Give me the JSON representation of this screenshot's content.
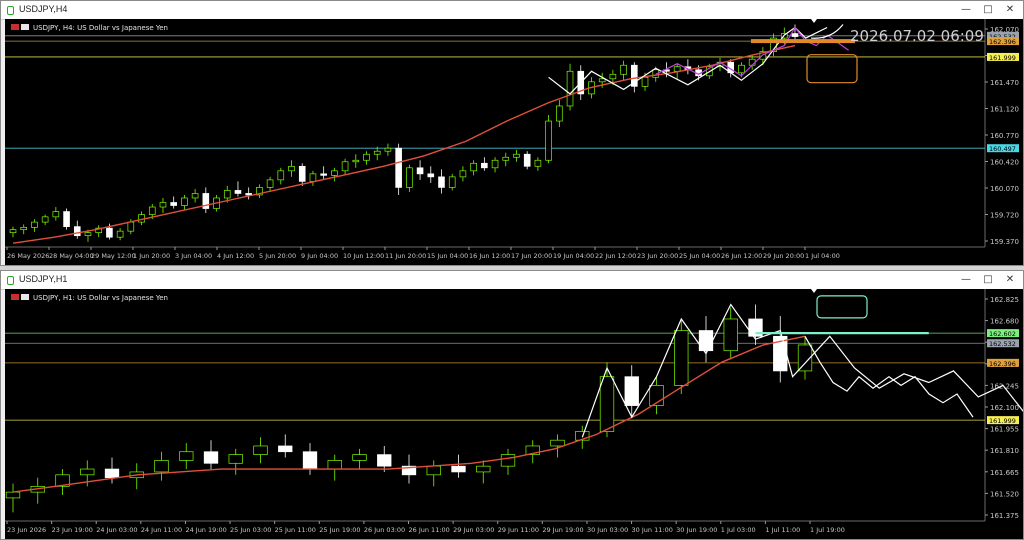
{
  "app": {
    "background": "#000000",
    "bull": "#7cfc00",
    "bear": "#ffffff",
    "ma_color": "#e0503c"
  },
  "windows": [
    {
      "id": "h4",
      "title": "USDJPY,H4",
      "symbol_label": "USDJPY, H4:  US Dollar vs Japanese Yen",
      "timestamp": "2026.07.02 06:09",
      "price_ticks": [
        "162.070",
        "161.820",
        "161.470",
        "161.120",
        "160.770",
        "160.420",
        "160.070",
        "159.720",
        "159.370"
      ],
      "price_range": [
        159.15,
        162.12
      ],
      "time_labels": [
        "26 May 2026",
        "28 May 04:00",
        "29 May 12:00",
        "1 Jun 20:00",
        "3 Jun 04:00",
        "4 Jun 12:00",
        "5 Jun 20:00",
        "9 Jun 04:00",
        "10 Jun 12:00",
        "11 Jun 20:00",
        "15 Jun 04:00",
        "16 Jun 12:00",
        "17 Jun 20:00",
        "19 Jun 04:00",
        "22 Jun 12:00",
        "23 Jun 20:00",
        "25 Jun 04:00",
        "26 Jun 12:00",
        "29 Jun 20:00",
        "1 Jul 04:00"
      ],
      "levels": [
        {
          "label": "162.532",
          "price": 161.95,
          "color": "#9aa3ad",
          "text": "#000000"
        },
        {
          "label": "162.396",
          "price": 161.88,
          "color": "#e0a03a",
          "text": "#000000"
        },
        {
          "label": "161.999",
          "price": 161.67,
          "color": "#f5ee55",
          "text": "#000000"
        },
        {
          "label": "160.497",
          "price": 160.46,
          "color": "#4ad6e6",
          "text": "#000000"
        }
      ],
      "candles": [
        [
          159.34,
          159.42,
          159.28,
          159.38
        ],
        [
          159.38,
          159.45,
          159.32,
          159.41
        ],
        [
          159.41,
          159.52,
          159.35,
          159.48
        ],
        [
          159.48,
          159.58,
          159.44,
          159.55
        ],
        [
          159.55,
          159.68,
          159.5,
          159.62
        ],
        [
          159.62,
          159.66,
          159.38,
          159.42
        ],
        [
          159.42,
          159.5,
          159.26,
          159.3
        ],
        [
          159.3,
          159.38,
          159.22,
          159.34
        ],
        [
          159.34,
          159.44,
          159.28,
          159.4
        ],
        [
          159.4,
          159.46,
          159.25,
          159.28
        ],
        [
          159.28,
          159.4,
          159.24,
          159.36
        ],
        [
          159.36,
          159.52,
          159.32,
          159.48
        ],
        [
          159.48,
          159.62,
          159.44,
          159.58
        ],
        [
          159.58,
          159.72,
          159.52,
          159.68
        ],
        [
          159.68,
          159.8,
          159.6,
          159.74
        ],
        [
          159.74,
          159.82,
          159.66,
          159.7
        ],
        [
          159.7,
          159.84,
          159.64,
          159.8
        ],
        [
          159.8,
          159.92,
          159.74,
          159.86
        ],
        [
          159.86,
          159.94,
          159.6,
          159.66
        ],
        [
          159.66,
          159.84,
          159.62,
          159.8
        ],
        [
          159.8,
          159.96,
          159.74,
          159.9
        ],
        [
          159.9,
          160.02,
          159.82,
          159.86
        ],
        [
          159.86,
          159.94,
          159.78,
          159.84
        ],
        [
          159.84,
          159.98,
          159.8,
          159.94
        ],
        [
          159.94,
          160.08,
          159.88,
          160.04
        ],
        [
          160.04,
          160.2,
          159.98,
          160.16
        ],
        [
          160.16,
          160.3,
          160.08,
          160.22
        ],
        [
          160.22,
          160.26,
          159.96,
          160.02
        ],
        [
          160.02,
          160.16,
          159.96,
          160.12
        ],
        [
          160.12,
          160.22,
          160.04,
          160.1
        ],
        [
          160.1,
          160.2,
          160.02,
          160.16
        ],
        [
          160.16,
          160.32,
          160.1,
          160.28
        ],
        [
          160.28,
          160.38,
          160.2,
          160.3
        ],
        [
          160.3,
          160.42,
          160.24,
          160.38
        ],
        [
          160.38,
          160.48,
          160.3,
          160.42
        ],
        [
          160.42,
          160.52,
          160.36,
          160.46
        ],
        [
          160.46,
          160.52,
          159.84,
          159.94
        ],
        [
          159.94,
          160.24,
          159.88,
          160.2
        ],
        [
          160.2,
          160.3,
          160.04,
          160.12
        ],
        [
          160.12,
          160.22,
          160.0,
          160.08
        ],
        [
          160.08,
          160.18,
          159.86,
          159.94
        ],
        [
          159.94,
          160.12,
          159.9,
          160.08
        ],
        [
          160.08,
          160.22,
          160.02,
          160.16
        ],
        [
          160.16,
          160.3,
          160.1,
          160.26
        ],
        [
          160.26,
          160.34,
          160.16,
          160.2
        ],
        [
          160.2,
          160.34,
          160.14,
          160.3
        ],
        [
          160.3,
          160.4,
          160.22,
          160.34
        ],
        [
          160.34,
          160.44,
          160.28,
          160.38
        ],
        [
          160.38,
          160.42,
          160.18,
          160.22
        ],
        [
          160.22,
          160.34,
          160.16,
          160.3
        ],
        [
          160.3,
          160.9,
          160.26,
          160.82
        ],
        [
          160.82,
          161.1,
          160.74,
          161.02
        ],
        [
          161.02,
          161.58,
          160.96,
          161.48
        ],
        [
          161.48,
          161.56,
          161.1,
          161.18
        ],
        [
          161.18,
          161.4,
          161.12,
          161.34
        ],
        [
          161.34,
          161.46,
          161.26,
          161.38
        ],
        [
          161.38,
          161.5,
          161.3,
          161.44
        ],
        [
          161.44,
          161.62,
          161.36,
          161.56
        ],
        [
          161.56,
          161.6,
          161.2,
          161.28
        ],
        [
          161.28,
          161.46,
          161.22,
          161.4
        ],
        [
          161.4,
          161.54,
          161.34,
          161.5
        ],
        [
          161.5,
          161.6,
          161.4,
          161.48
        ],
        [
          161.48,
          161.58,
          161.38,
          161.54
        ],
        [
          161.54,
          161.64,
          161.44,
          161.5
        ],
        [
          161.5,
          161.56,
          161.36,
          161.42
        ],
        [
          161.42,
          161.58,
          161.38,
          161.54
        ],
        [
          161.54,
          161.66,
          161.48,
          161.6
        ],
        [
          161.6,
          161.64,
          161.4,
          161.46
        ],
        [
          161.46,
          161.6,
          161.4,
          161.56
        ],
        [
          161.56,
          161.7,
          161.5,
          161.64
        ],
        [
          161.64,
          161.8,
          161.56,
          161.74
        ],
        [
          161.74,
          161.98,
          161.68,
          161.92
        ],
        [
          161.92,
          162.06,
          161.84,
          161.98
        ],
        [
          161.98,
          162.1,
          161.86,
          161.94
        ]
      ],
      "ma": [
        159.2,
        159.28,
        159.38,
        159.5,
        159.62,
        159.74,
        159.86,
        159.98,
        160.1,
        160.22,
        160.36,
        160.55,
        160.82,
        161.06,
        161.26,
        161.38,
        161.46,
        161.56,
        161.7,
        161.82
      ],
      "white_zigzag": [
        [
          50,
          161.4
        ],
        [
          52,
          161.18
        ],
        [
          54,
          161.48
        ],
        [
          57,
          161.24
        ],
        [
          60,
          161.52
        ],
        [
          63,
          161.3
        ],
        [
          66,
          161.56
        ],
        [
          68,
          161.36
        ],
        [
          70,
          161.58
        ],
        [
          72,
          161.96
        ],
        [
          73,
          162.06
        ],
        [
          74,
          161.92
        ],
        [
          76,
          162.06
        ]
      ],
      "magenta_zigzag": [
        [
          60,
          161.44
        ],
        [
          62,
          161.58
        ],
        [
          64,
          161.44
        ],
        [
          66,
          161.6
        ],
        [
          68,
          161.42
        ],
        [
          70,
          161.7
        ],
        [
          72,
          161.82
        ],
        [
          73,
          162.06
        ],
        [
          74,
          161.88
        ],
        [
          75,
          161.82
        ],
        [
          76,
          161.96
        ],
        [
          78,
          161.76
        ]
      ],
      "box_label": ""
    },
    {
      "id": "h1",
      "title": "USDJPY,H1",
      "symbol_label": "USDJPY, H1:  US Dollar vs Japanese Yen",
      "price_ticks": [
        "162.825",
        "162.680",
        "162.535",
        "162.390",
        "162.245",
        "162.100",
        "161.955",
        "161.810",
        "161.665",
        "161.520",
        "161.375"
      ],
      "price_range": [
        161.3,
        162.88
      ],
      "time_labels": [
        "23 Jun 2026",
        "23 Jun 19:00",
        "24 Jun 03:00",
        "24 Jun 11:00",
        "24 Jun 19:00",
        "25 Jun 03:00",
        "25 Jun 11:00",
        "25 Jun 19:00",
        "26 Jun 03:00",
        "26 Jun 11:00",
        "29 Jun 03:00",
        "29 Jun 11:00",
        "29 Jun 19:00",
        "30 Jun 03:00",
        "30 Jun 11:00",
        "30 Jun 19:00",
        "1 Jul 03:00",
        "1 Jul 11:00",
        "1 Jul 19:00"
      ],
      "levels": [
        {
          "label": "162.602",
          "price": 162.602,
          "color": "#7cf07c",
          "text": "#000000"
        },
        {
          "label": "162.532",
          "price": 162.532,
          "color": "#9aa3ad",
          "text": "#000000"
        },
        {
          "label": "162.396",
          "price": 162.396,
          "color": "#e0a03a",
          "text": "#000000"
        },
        {
          "label": "161.999",
          "price": 161.999,
          "color": "#f5ee55",
          "text": "#000000"
        }
      ],
      "candles": [
        [
          161.46,
          161.56,
          161.36,
          161.5
        ],
        [
          161.5,
          161.6,
          161.42,
          161.54
        ],
        [
          161.54,
          161.66,
          161.48,
          161.62
        ],
        [
          161.62,
          161.72,
          161.54,
          161.66
        ],
        [
          161.66,
          161.74,
          161.56,
          161.6
        ],
        [
          161.6,
          161.7,
          161.52,
          161.64
        ],
        [
          161.64,
          161.78,
          161.58,
          161.72
        ],
        [
          161.72,
          161.84,
          161.66,
          161.78
        ],
        [
          161.78,
          161.86,
          161.66,
          161.7
        ],
        [
          161.7,
          161.8,
          161.62,
          161.76
        ],
        [
          161.76,
          161.88,
          161.7,
          161.82
        ],
        [
          161.82,
          161.9,
          161.74,
          161.78
        ],
        [
          161.78,
          161.84,
          161.62,
          161.66
        ],
        [
          161.66,
          161.76,
          161.58,
          161.72
        ],
        [
          161.72,
          161.8,
          161.66,
          161.76
        ],
        [
          161.76,
          161.82,
          161.64,
          161.68
        ],
        [
          161.68,
          161.76,
          161.56,
          161.62
        ],
        [
          161.62,
          161.72,
          161.54,
          161.68
        ],
        [
          161.68,
          161.76,
          161.6,
          161.64
        ],
        [
          161.64,
          161.72,
          161.56,
          161.68
        ],
        [
          161.68,
          161.8,
          161.62,
          161.76
        ],
        [
          161.76,
          161.86,
          161.7,
          161.82
        ],
        [
          161.82,
          161.9,
          161.74,
          161.86
        ],
        [
          161.86,
          161.96,
          161.8,
          161.92
        ],
        [
          161.92,
          162.4,
          161.88,
          162.3
        ],
        [
          162.3,
          162.38,
          162.02,
          162.1
        ],
        [
          162.1,
          162.3,
          162.04,
          162.24
        ],
        [
          162.24,
          162.7,
          162.18,
          162.62
        ],
        [
          162.62,
          162.72,
          162.4,
          162.48
        ],
        [
          162.48,
          162.78,
          162.42,
          162.7
        ],
        [
          162.7,
          162.8,
          162.52,
          162.58
        ],
        [
          162.58,
          162.72,
          162.26,
          162.34
        ],
        [
          162.34,
          162.58,
          162.28,
          162.52
        ]
      ],
      "ma": [
        161.5,
        161.54,
        161.58,
        161.62,
        161.64,
        161.66,
        161.66,
        161.66,
        161.66,
        161.66,
        161.68,
        161.7,
        161.74,
        161.8,
        161.9,
        162.04,
        162.22,
        162.4,
        162.52,
        162.58
      ],
      "white_zigzag": [
        [
          23,
          161.88
        ],
        [
          24,
          162.36
        ],
        [
          25,
          162.02
        ],
        [
          26,
          162.3
        ],
        [
          27,
          162.7
        ],
        [
          28,
          162.46
        ],
        [
          29,
          162.8
        ],
        [
          30,
          162.56
        ],
        [
          31,
          162.62
        ],
        [
          31.5,
          162.3
        ],
        [
          33,
          162.58
        ],
        [
          34,
          162.36
        ],
        [
          35,
          162.22
        ],
        [
          36,
          162.32
        ],
        [
          37,
          162.26
        ],
        [
          38,
          162.34
        ],
        [
          39,
          162.16
        ],
        [
          40,
          162.24
        ],
        [
          41,
          162.02
        ]
      ],
      "teal_segment": [
        [
          30,
          162.602
        ],
        [
          37,
          162.602
        ]
      ]
    }
  ]
}
